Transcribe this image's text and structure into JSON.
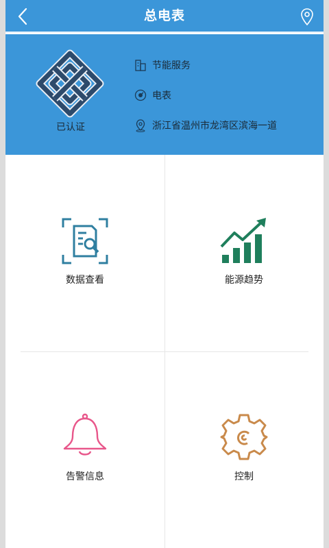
{
  "header": {
    "title": "总电表"
  },
  "panel": {
    "cert_label": "已认证",
    "service": "节能服务",
    "meter": "电表",
    "address": "浙江省温州市龙湾区滨海一道"
  },
  "menu": [
    {
      "label": "数据查看",
      "icon": "data-view-icon"
    },
    {
      "label": "能源趋势",
      "icon": "trend-chart-icon"
    },
    {
      "label": "告警信息",
      "icon": "bell-icon"
    },
    {
      "label": "控制",
      "icon": "gear-icon"
    }
  ],
  "colors": {
    "primary": "#3b96d9",
    "data_icon": "#2f7fa0",
    "trend_icon": "#1f7f5c",
    "alarm_icon": "#e8568a",
    "control_icon": "#c98a4b"
  }
}
